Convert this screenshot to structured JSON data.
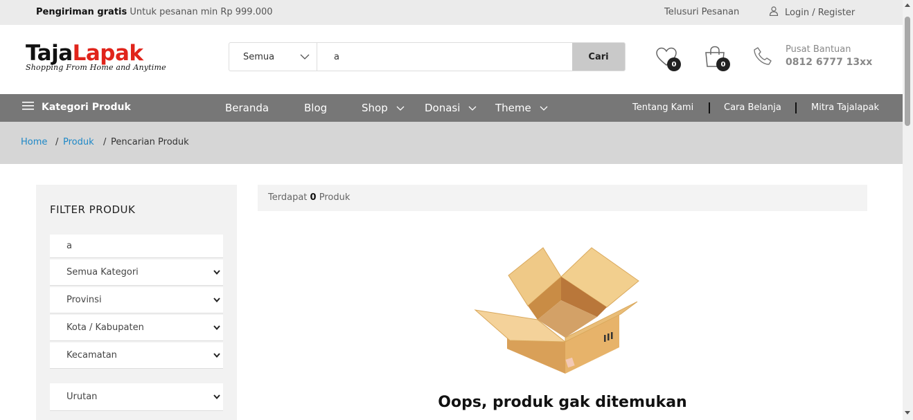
{
  "topbar": {
    "promo_bold": "Pengiriman gratis",
    "promo_text": "Untuk pesanan min Rp 999.000",
    "track_label": "Telusuri Pesanan",
    "login_label": "Login / Register"
  },
  "header": {
    "logo_part1": "Taja",
    "logo_part2": "Lapak",
    "logo_tagline": "Shopping From Home and Anytime",
    "search": {
      "category_value": "Semua",
      "query_value": "a",
      "button_label": "Cari"
    },
    "wishlist_count": "0",
    "cart_count": "0",
    "help_label": "Pusat Bantuan",
    "help_phone": "0812 6777 13xx"
  },
  "nav": {
    "categories_label": "Kategori Produk",
    "items": [
      {
        "label": "Beranda"
      },
      {
        "label": "Blog"
      },
      {
        "label": "Shop"
      },
      {
        "label": "Donasi"
      },
      {
        "label": "Theme"
      }
    ],
    "right_links": [
      {
        "label": "Tentang Kami"
      },
      {
        "label": "Cara Belanja"
      },
      {
        "label": "Mitra Tajalapak"
      }
    ]
  },
  "breadcrumb": {
    "home": "Home",
    "produk": "Produk",
    "current": "Pencarian Produk",
    "separator": "/"
  },
  "sidebar": {
    "title": "FILTER PRODUK",
    "search_value": "a",
    "selects": [
      {
        "label": "Semua Kategori"
      },
      {
        "label": "Provinsi"
      },
      {
        "label": "Kota / Kabupaten"
      },
      {
        "label": "Kecamatan"
      }
    ],
    "sort_label": "Urutan"
  },
  "results": {
    "prefix": "Terdapat",
    "count": "0",
    "suffix": "Produk",
    "empty_message": "Oops, produk gak ditemukan"
  },
  "colors": {
    "nav_bg": "#777777",
    "logo_red": "#e0241b",
    "link_blue": "#1e88c7"
  }
}
